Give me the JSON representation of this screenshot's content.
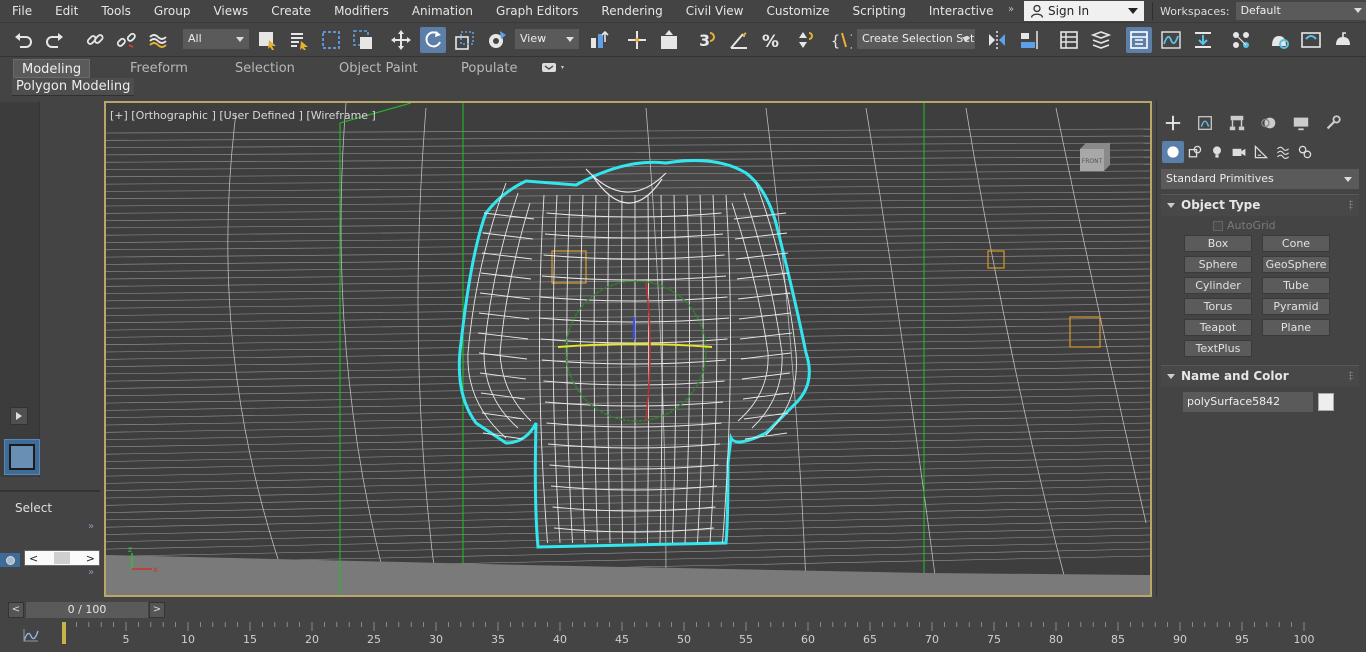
{
  "menu": {
    "items": [
      "File",
      "Edit",
      "Tools",
      "Group",
      "Views",
      "Create",
      "Modifiers",
      "Animation",
      "Graph Editors",
      "Rendering",
      "Civil View",
      "Customize",
      "Scripting",
      "Interactive"
    ],
    "sign_in": "Sign In",
    "workspaces_label": "Workspaces:",
    "workspaces_value": "Default"
  },
  "toolbar": {
    "filter_value": "All",
    "refcoord_value": "View",
    "selection_set_placeholder": "Create Selection Set"
  },
  "ribbon": {
    "tabs": [
      "Modeling",
      "Freeform",
      "Selection",
      "Object Paint",
      "Populate"
    ],
    "active_tab": "Modeling",
    "sub_label": "Polygon Modeling"
  },
  "left_panel": {
    "select_label": "Select",
    "scroll_left": "<",
    "scroll_right": ">",
    "collapse_glyph": "»"
  },
  "viewport": {
    "label": "[+] [Orthographic ] [User Defined ] [Wireframe ]",
    "viewcube_label": "FRONT",
    "colors": {
      "border": "#b8a66a",
      "selection": "#33e6ee",
      "wire": "#e8e8e8",
      "grid_green": "#22c022"
    }
  },
  "command_panel": {
    "category": "Standard Primitives",
    "object_type_title": "Object Type",
    "autogrid": "AutoGrid",
    "buttons": [
      "Box",
      "Cone",
      "Sphere",
      "GeoSphere",
      "Cylinder",
      "Tube",
      "Torus",
      "Pyramid",
      "Teapot",
      "Plane",
      "TextPlus"
    ],
    "name_color_title": "Name and Color",
    "object_name": "polySurface5842",
    "object_color": "#eeeeee"
  },
  "timeline": {
    "frame_display": "0 / 100",
    "prev": "<",
    "next": ">",
    "ticks": [
      "5",
      "10",
      "15",
      "20",
      "25",
      "30",
      "35",
      "40",
      "45",
      "50",
      "55",
      "60",
      "65",
      "70",
      "75",
      "80",
      "85",
      "90",
      "95",
      "100"
    ]
  }
}
